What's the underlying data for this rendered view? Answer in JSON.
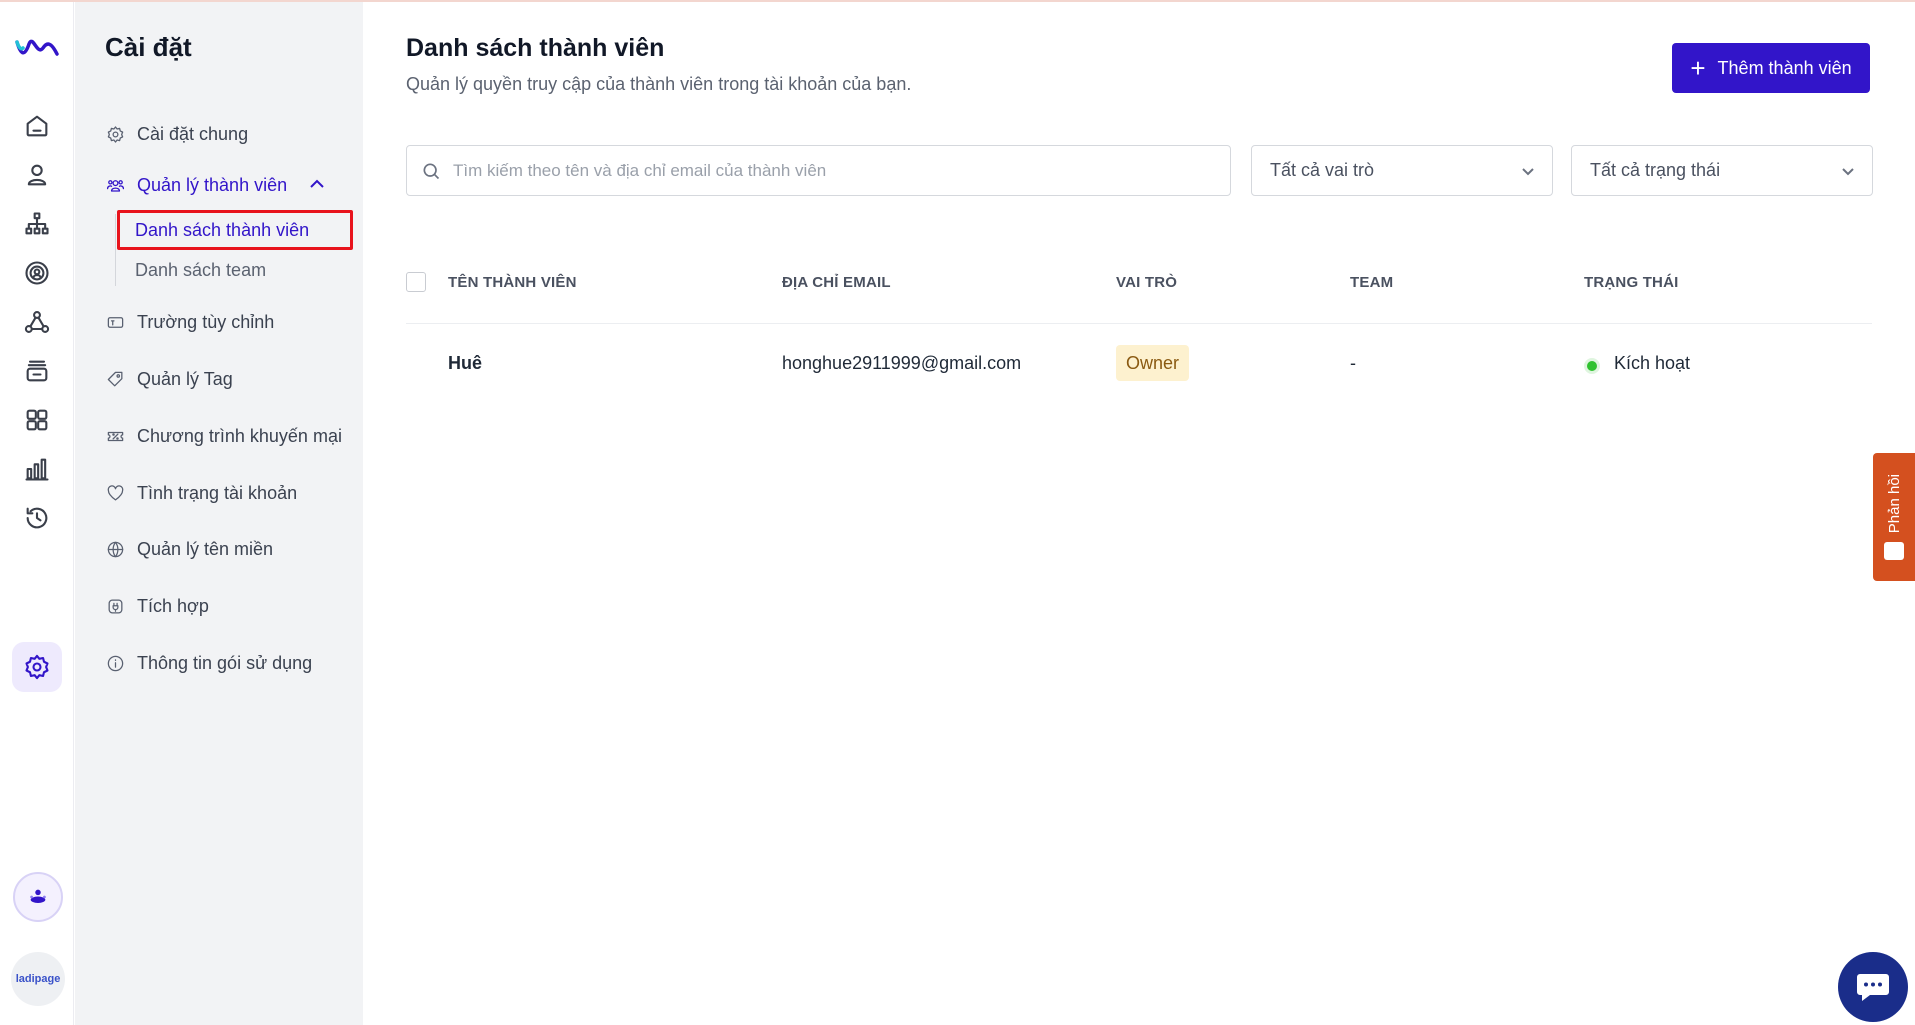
{
  "colors": {
    "accent": "#3215c9",
    "highlight_box": "#e8131c",
    "status_active": "#2fc22f",
    "feedback": "#d4501f",
    "badge_bg": "#fdf1cf"
  },
  "rail": {
    "icons": [
      "brand-logo-icon",
      "home-icon",
      "user-icon",
      "org-chart-icon",
      "target-user-icon",
      "network-icon",
      "inbox-icon",
      "apps-grid-icon",
      "bar-chart-icon",
      "history-icon",
      "settings-icon"
    ],
    "active": "settings-icon",
    "brand_text": "ladipage"
  },
  "sidebar": {
    "title": "Cài đặt",
    "items": [
      {
        "label": "Cài đặt chung",
        "icon": "gear-icon"
      },
      {
        "label": "Quản lý thành viên",
        "icon": "users-icon",
        "active": true,
        "expanded": true
      },
      {
        "label": "Trường tùy chỉnh",
        "icon": "custom-field-icon"
      },
      {
        "label": "Quản lý Tag",
        "icon": "tag-icon"
      },
      {
        "label": "Chương trình khuyến mại",
        "icon": "promotion-icon"
      },
      {
        "label": "Tình trạng tài khoản",
        "icon": "heart-icon"
      },
      {
        "label": "Quản lý tên miền",
        "icon": "globe-icon"
      },
      {
        "label": "Tích hợp",
        "icon": "plug-icon"
      },
      {
        "label": "Thông tin gói sử dụng",
        "icon": "info-icon"
      }
    ],
    "sub_items": [
      {
        "label": "Danh sách thành viên",
        "active": true
      },
      {
        "label": "Danh sách team"
      }
    ]
  },
  "main": {
    "title": "Danh sách thành viên",
    "subtitle": "Quản lý quyền truy cập của thành viên trong tài khoản của bạn.",
    "add_button": "Thêm thành viên",
    "search_placeholder": "Tìm kiếm theo tên và địa chỉ email của thành viên",
    "role_filter": "Tất cả vai trò",
    "status_filter": "Tất cả trạng thái",
    "columns": [
      "TÊN THÀNH VIÊN",
      "ĐỊA CHỈ EMAIL",
      "VAI TRÒ",
      "TEAM",
      "TRẠNG THÁI"
    ],
    "rows": [
      {
        "name": "Huê",
        "email": "honghue2911999@gmail.com",
        "role": "Owner",
        "team": "-",
        "status": "Kích hoạt"
      }
    ]
  },
  "feedback": {
    "label": "Phản hồi"
  }
}
